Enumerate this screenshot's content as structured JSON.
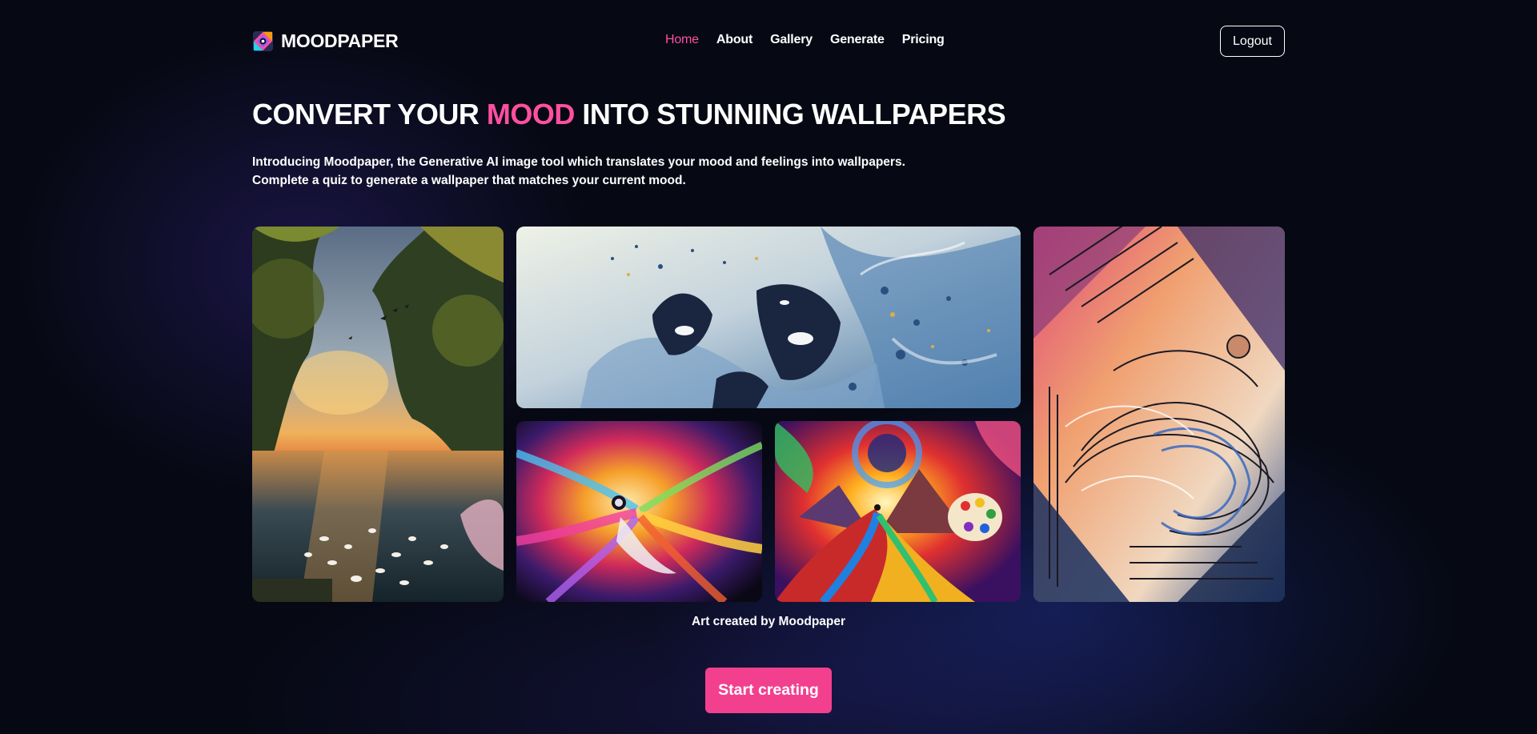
{
  "brand": {
    "name": "MOODPAPER",
    "logo_icon": "moodpaper-logo-icon"
  },
  "nav": {
    "items": [
      {
        "label": "Home",
        "active": true
      },
      {
        "label": "About",
        "active": false
      },
      {
        "label": "Gallery",
        "active": false
      },
      {
        "label": "Generate",
        "active": false
      },
      {
        "label": "Pricing",
        "active": false
      }
    ],
    "logout_label": "Logout"
  },
  "hero": {
    "title_before": "CONVERT YOUR",
    "title_accent": "MOOD",
    "title_after": "INTO STUNNING WALLPAPERS",
    "intro_line1": "Introducing Moodpaper, the Generative AI image tool which translates your mood and feelings into wallpapers.",
    "intro_line2": "Complete a quiz to generate a wallpaper that matches your current mood."
  },
  "gallery": {
    "images": [
      {
        "subject": "sunset forest lake with swans"
      },
      {
        "subject": "orcas leaping in abstract blue waves"
      },
      {
        "subject": "colorful abstract explosion figure"
      },
      {
        "subject": "vivid mountain sunburst with palette"
      },
      {
        "subject": "geometric art deco swirls"
      }
    ],
    "caption": "Art created by Moodpaper"
  },
  "cta": {
    "label": "Start creating"
  },
  "colors": {
    "accent": "#ff4fa0",
    "cta_background": "#f2408f",
    "background": "#060913"
  }
}
